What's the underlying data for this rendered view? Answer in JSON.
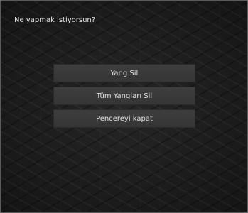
{
  "dialog": {
    "prompt": "Ne yapmak istiyorsun?",
    "buttons": [
      {
        "label": "Yang Sil"
      },
      {
        "label": "Tüm Yangları Sil"
      },
      {
        "label": "Pencereyi kapat"
      }
    ]
  }
}
